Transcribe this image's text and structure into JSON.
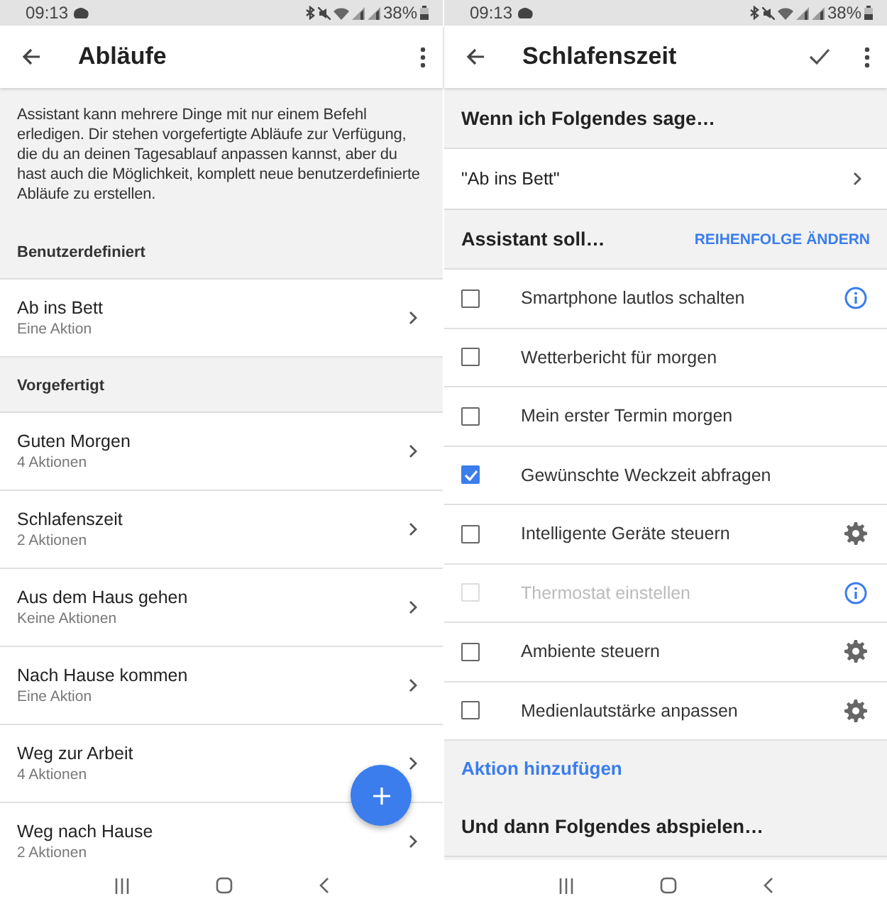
{
  "screens": [
    {
      "kind": "routines_list",
      "status_bar": {
        "time": "09:13",
        "battery": "38%"
      },
      "app_bar": {
        "title": "Abläufe"
      },
      "intro": "Assistant kann mehrere Dinge mit nur einem Befehl erledigen. Dir stehen vorgefertigte Abläufe zur Verfügung, die du an deinen Tagesablauf anpassen kannst, aber du hast auch die Möglichkeit, komplett neue benutzerdefinierte Abläufe zu erstellen.",
      "sections": [
        {
          "title": "Benutzerdefiniert",
          "items": [
            {
              "title": "Ab ins Bett",
              "subtitle": "Eine Aktion"
            }
          ]
        },
        {
          "title": "Vorgefertigt",
          "items": [
            {
              "title": "Guten Morgen",
              "subtitle": "4 Aktionen"
            },
            {
              "title": "Schlafenszeit",
              "subtitle": "2 Aktionen"
            },
            {
              "title": "Aus dem Haus gehen",
              "subtitle": "Keine Aktionen"
            },
            {
              "title": "Nach Hause kommen",
              "subtitle": "Eine Aktion"
            },
            {
              "title": "Weg zur Arbeit",
              "subtitle": "4 Aktionen"
            },
            {
              "title": "Weg nach Hause",
              "subtitle": "2 Aktionen"
            }
          ]
        }
      ]
    },
    {
      "kind": "routine_editor",
      "status_bar": {
        "time": "09:13",
        "battery": "38%"
      },
      "app_bar": {
        "title": "Schlafenszeit"
      },
      "trigger_header": "Wenn ich Folgendes sage…",
      "trigger_phrase": "\"Ab ins Bett\"",
      "actions_header": "Assistant soll…",
      "reorder_link": "REIHENFOLGE ÄNDERN",
      "actions": [
        {
          "kind": "info",
          "label": "Smartphone lautlos schalten",
          "checked": false,
          "disabled": false
        },
        {
          "kind": "plain",
          "label": "Wetterbericht für morgen",
          "checked": false,
          "disabled": false
        },
        {
          "kind": "plain",
          "label": "Mein erster Termin morgen",
          "checked": false,
          "disabled": false
        },
        {
          "kind": "plain",
          "label": "Gewünschte Weckzeit abfragen",
          "checked": true,
          "disabled": false
        },
        {
          "kind": "settings",
          "label": "Intelligente Geräte steuern",
          "checked": false,
          "disabled": false
        },
        {
          "kind": "info",
          "label": "Thermostat einstellen",
          "checked": false,
          "disabled": true
        },
        {
          "kind": "settings",
          "label": "Ambiente steuern",
          "checked": false,
          "disabled": false
        },
        {
          "kind": "settings",
          "label": "Medienlautstärke anpassen",
          "checked": false,
          "disabled": false
        }
      ],
      "add_action": "Aktion hinzufügen",
      "then_header": "Und dann Folgendes abspielen…"
    }
  ]
}
